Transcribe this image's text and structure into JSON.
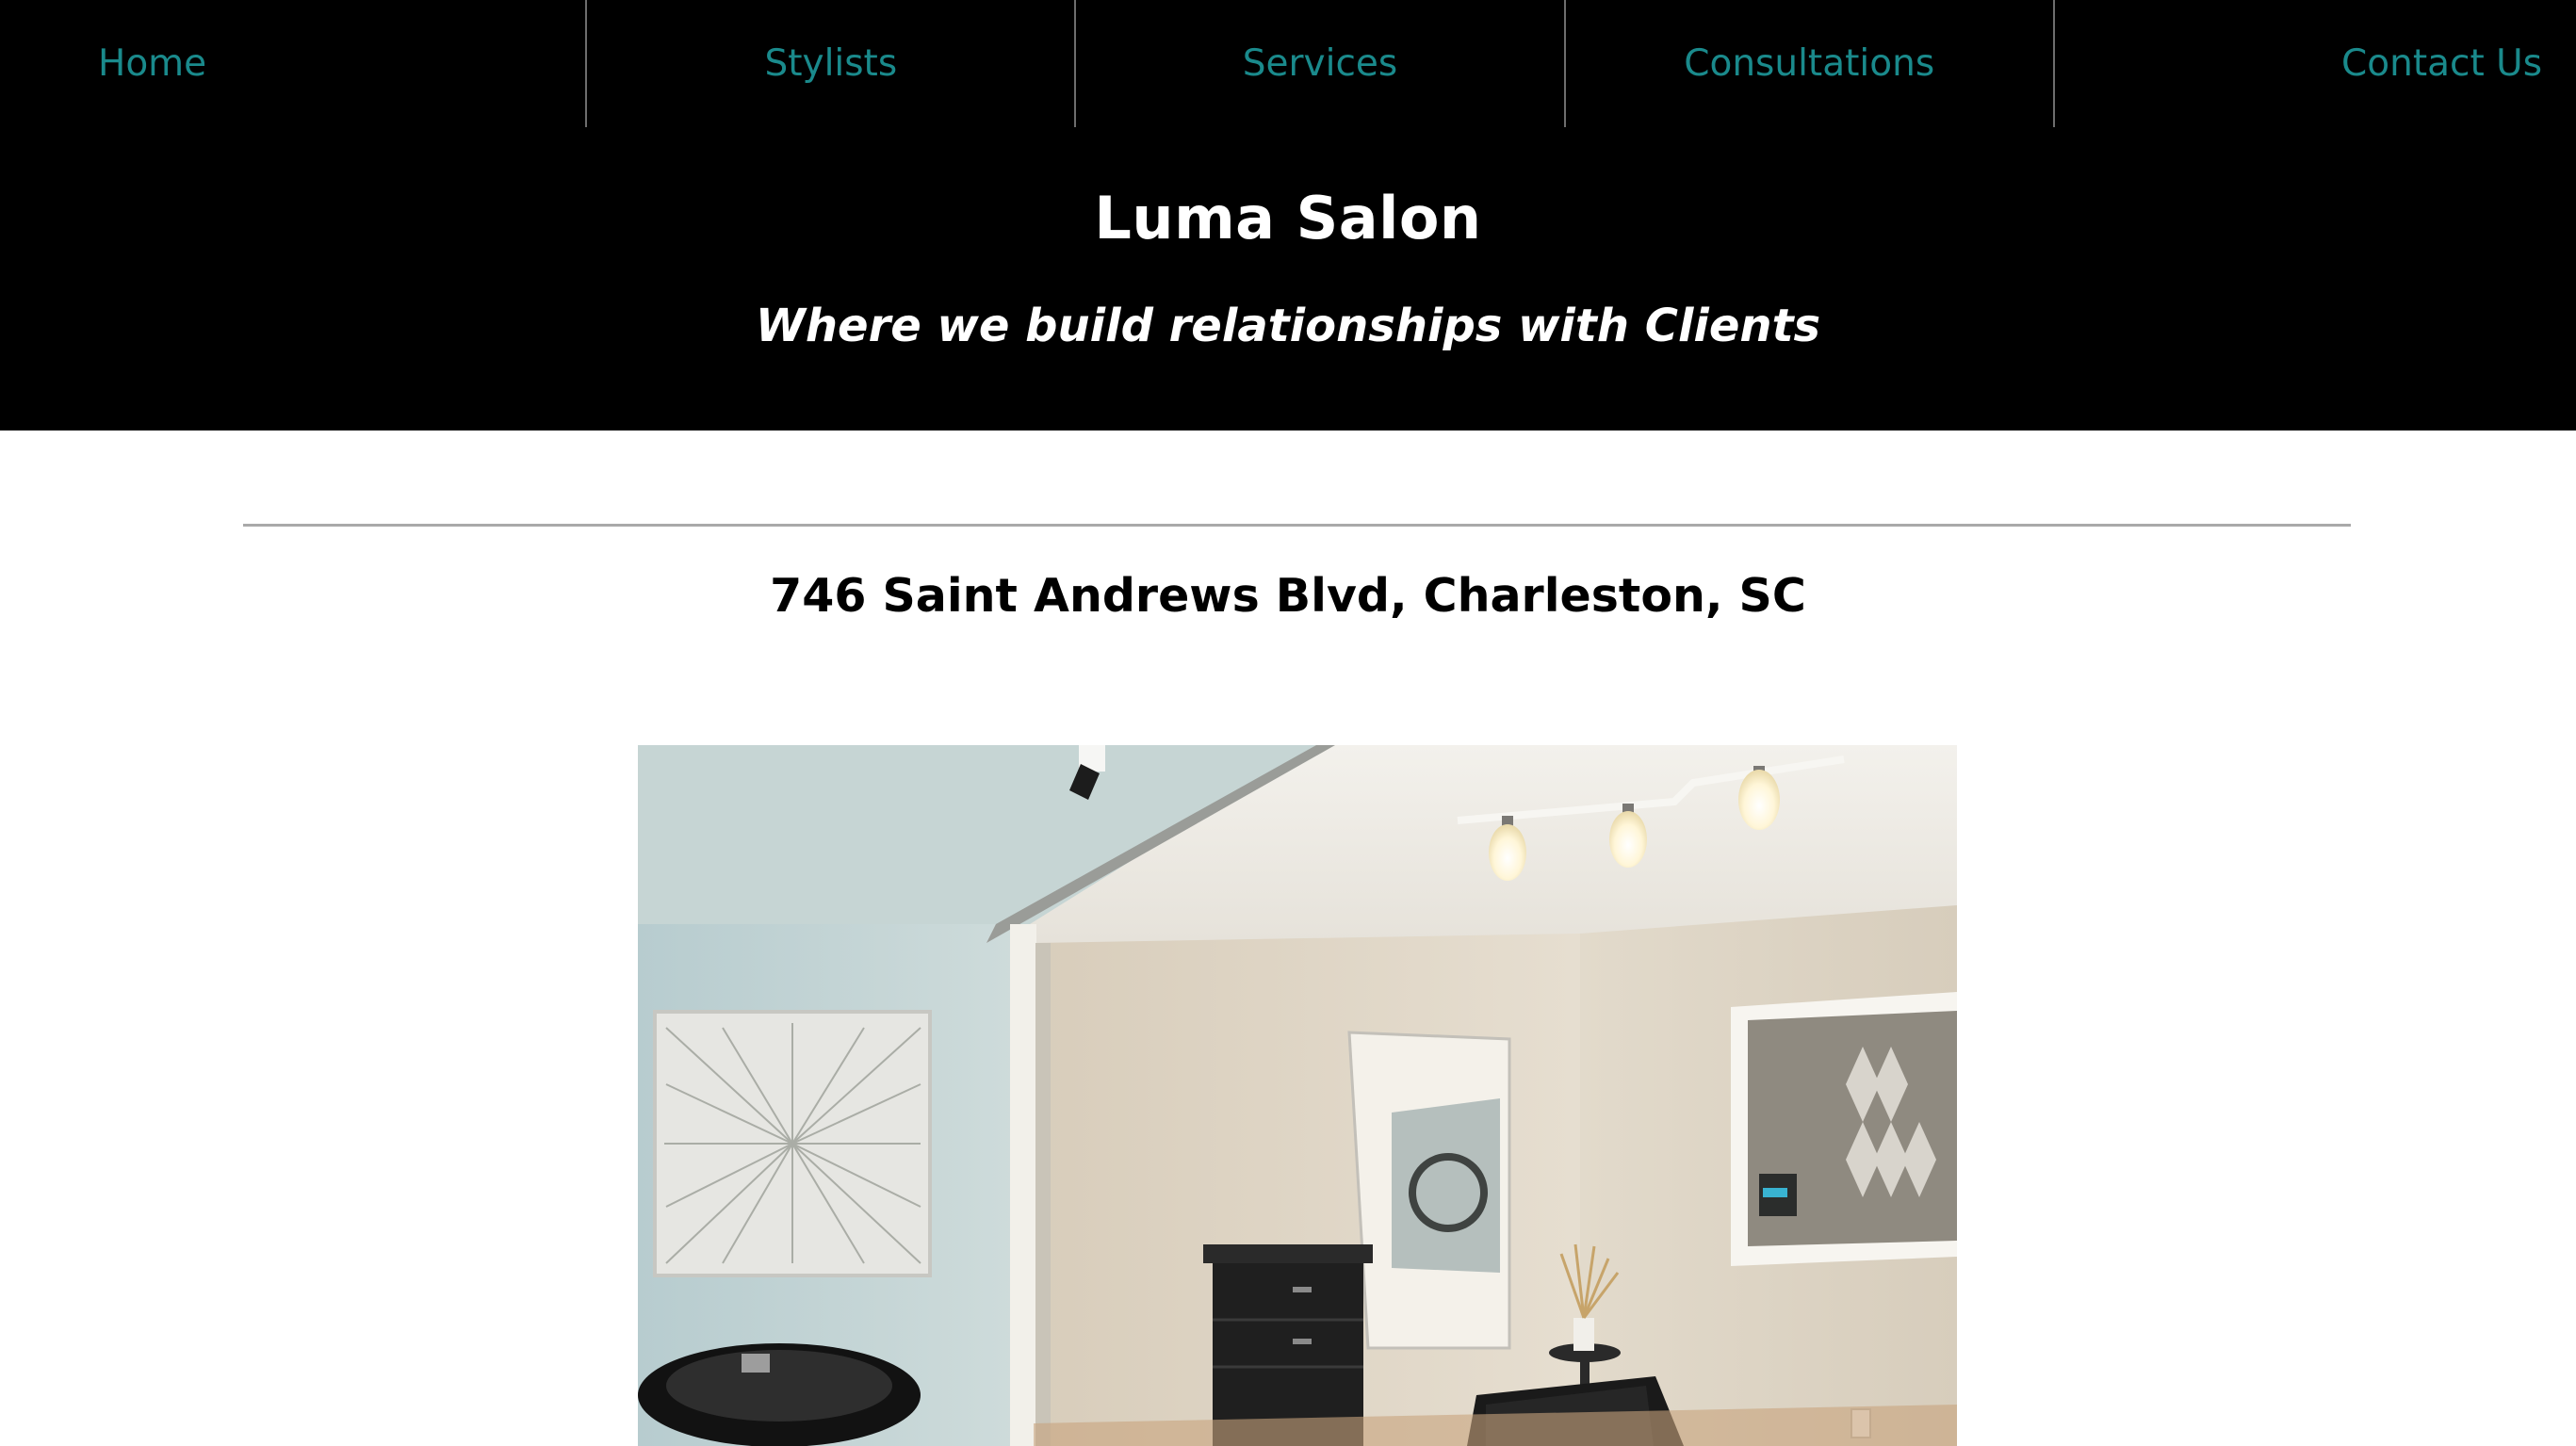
{
  "nav": {
    "items": [
      {
        "label": "Home"
      },
      {
        "label": "Stylists"
      },
      {
        "label": "Services"
      },
      {
        "label": "Consultations"
      },
      {
        "label": "Contact Us"
      }
    ],
    "color": "#1a8a8c"
  },
  "header": {
    "title": "Luma Salon",
    "tagline": "Where we build relationships with Clients",
    "background": "#000000"
  },
  "main": {
    "address": "746 Saint Andrews Blvd, Charleston, SC",
    "photo_icon": "salon-interior-photo"
  }
}
